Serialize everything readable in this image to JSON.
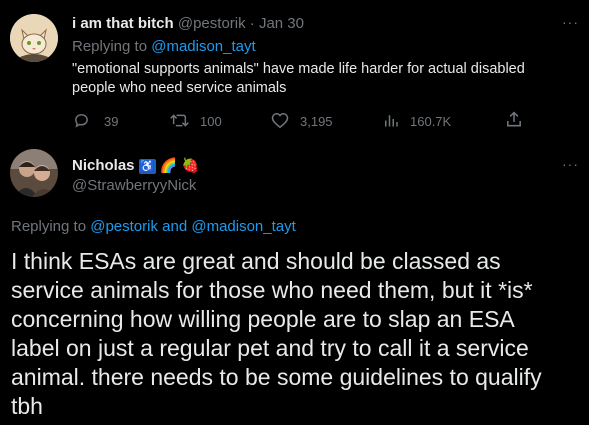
{
  "tweet1": {
    "display_name": "i am that bitch",
    "handle": "@pestorik",
    "separator": "·",
    "date": "Jan 30",
    "replying_prefix": "Replying to",
    "replying_to": "@madison_tayt",
    "text_line1": "\"emotional supports animals\" have made life harder for actual disabled",
    "text_line2": "people who need service animals",
    "stats": {
      "replies": "39",
      "retweets": "100",
      "likes": "3,195",
      "views": "160.7K"
    }
  },
  "tweet2": {
    "display_name": "Nicholas",
    "badges": [
      "♿",
      "🌈",
      "🍓"
    ],
    "handle": "@StrawberryyNick",
    "replying_prefix": "Replying to",
    "replying_to_1": "@pestorik",
    "replying_and": "and",
    "replying_to_2": "@madison_tayt",
    "body_lines": [
      "I think ESAs are great and should be classed as",
      "service animals for those who need them, but it *is*",
      "concerning how willing people are to slap an ESA",
      "label on just a regular pet and try to call it a service",
      "animal. there needs to be some guidelines to qualify",
      "tbh"
    ]
  },
  "colors": {
    "background": "#000000",
    "text": "#e7e9ea",
    "muted": "#71767b",
    "accent": "#1d9bf0"
  },
  "icons": {
    "more": "more-icon",
    "reply": "reply-icon",
    "retweet": "retweet-icon",
    "like": "heart-icon",
    "views": "views-icon",
    "share": "share-icon"
  }
}
